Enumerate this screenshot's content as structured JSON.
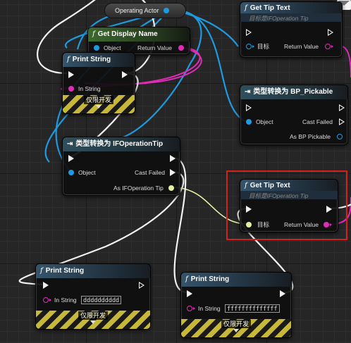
{
  "nodes": {
    "operating_actor": {
      "label": "Operating Actor"
    },
    "get_display_name": {
      "title": "Get Display Name",
      "object_pin": "Object",
      "return_pin": "Return Value"
    },
    "print_string_top": {
      "title": "Print String",
      "in_string": "In String",
      "dev_only": "仅限开发"
    },
    "cast_ifoperationtip": {
      "title": "类型转换为 IFOperationTip",
      "object_pin": "Object",
      "cast_failed_pin": "Cast Failed",
      "as_pin": "As IFOperation Tip"
    },
    "get_tip_text_top": {
      "title": "Get Tip Text",
      "subtitle": "目标是IFOperation Tip",
      "target_pin": "目标",
      "return_pin": "Return Value"
    },
    "cast_bp_pickable": {
      "title": "类型转换为 BP_Pickable",
      "object_pin": "Object",
      "cast_failed_pin": "Cast Failed",
      "as_pin": "As BP Pickable"
    },
    "get_tip_text_mid": {
      "title": "Get Tip Text",
      "subtitle": "目标是IFOperation Tip",
      "target_pin": "目标",
      "return_pin": "Return Value"
    },
    "print_string_left": {
      "title": "Print String",
      "in_string": "In String",
      "in_string_value": "dddddddddd",
      "dev_only": "仅限开发"
    },
    "print_string_right": {
      "title": "Print String",
      "in_string": "In String",
      "in_string_value": "ffffffffffffff",
      "dev_only": "仅限开发"
    }
  },
  "colors": {
    "exec_wire": "#f2f2f2",
    "object_wire": "#1e9be0",
    "string_wire": "#e02db8",
    "interface_wire": "#e6f0a0",
    "highlight": "#d62020"
  },
  "icons": {
    "function": "f-function-icon",
    "cast": "cast-arrow-icon",
    "mail": "mail-icon"
  }
}
